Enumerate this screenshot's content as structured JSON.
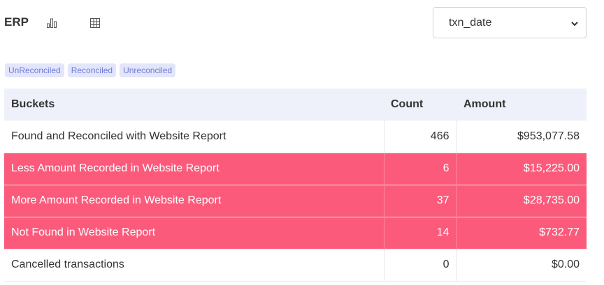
{
  "header": {
    "title": "ERP",
    "icons": [
      "bar-chart-icon",
      "table-grid-icon"
    ],
    "date_field_select": {
      "value": "txn_date"
    }
  },
  "filters": [
    "UnReconciled",
    "Reconciled",
    "Unreconciled"
  ],
  "table": {
    "columns": [
      "Buckets",
      "Count",
      "Amount"
    ],
    "rows": [
      {
        "bucket": "Found and Reconciled with Website Report",
        "count": "466",
        "amount": "$953,077.58",
        "highlight": false
      },
      {
        "bucket": "Less Amount Recorded in Website Report",
        "count": "6",
        "amount": "$15,225.00",
        "highlight": true
      },
      {
        "bucket": "More Amount Recorded in Website Report",
        "count": "37",
        "amount": "$28,735.00",
        "highlight": true
      },
      {
        "bucket": "Not Found in Website Report",
        "count": "14",
        "amount": "$732.77",
        "highlight": true
      },
      {
        "bucket": "Cancelled transactions",
        "count": "0",
        "amount": "$0.00",
        "highlight": false
      }
    ]
  },
  "colors": {
    "highlight_row": "#fc5a7b",
    "badge_bg": "#e3e6fa",
    "badge_text": "#6f7bd9",
    "header_row": "#eef1f9"
  }
}
